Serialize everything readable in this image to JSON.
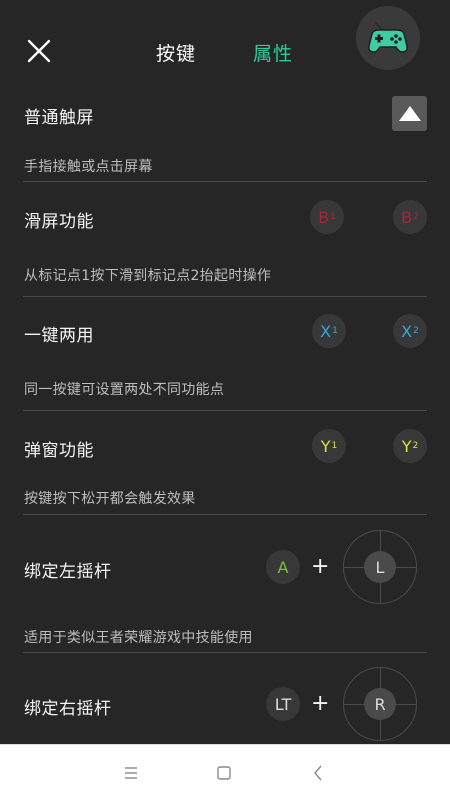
{
  "header": {
    "tab_keys": "按键",
    "tab_attrs": "属性",
    "accent": "#2fcc9a",
    "gamepad_color": "#3fcca0"
  },
  "rows": [
    {
      "title": "普通触屏",
      "desc": "手指接触或点击屏幕",
      "control": "triangle-up-icon"
    },
    {
      "title": "滑屏功能",
      "desc": "从标记点1按下滑到标记点2抬起时操作",
      "buttons": [
        {
          "letter": "B",
          "sub": "1",
          "color": "#a3283a"
        },
        {
          "letter": "B",
          "sub": "2",
          "color": "#a3283a"
        }
      ]
    },
    {
      "title": "一键两用",
      "desc": "同一按键可设置两处不同功能点",
      "buttons": [
        {
          "letter": "X",
          "sub": "1",
          "color": "#35a3dc"
        },
        {
          "letter": "X",
          "sub": "2",
          "color": "#35a3dc"
        }
      ]
    },
    {
      "title": "弹窗功能",
      "desc": "按键按下松开都会触发效果",
      "buttons": [
        {
          "letter": "Y",
          "sub": "1",
          "color": "#e6dc45"
        },
        {
          "letter": "Y",
          "sub": "2",
          "color": "#e6dc45"
        }
      ]
    },
    {
      "title": "绑定左摇杆",
      "desc": "适用于类似王者荣耀游戏中技能使用",
      "button": "A",
      "plus": "+",
      "stick": "L"
    },
    {
      "title": "绑定右摇杆",
      "button": "LT",
      "plus": "+",
      "stick": "R"
    }
  ],
  "navbar": {
    "icons": [
      "menu-icon",
      "home-square-icon",
      "back-chevron-icon"
    ]
  }
}
